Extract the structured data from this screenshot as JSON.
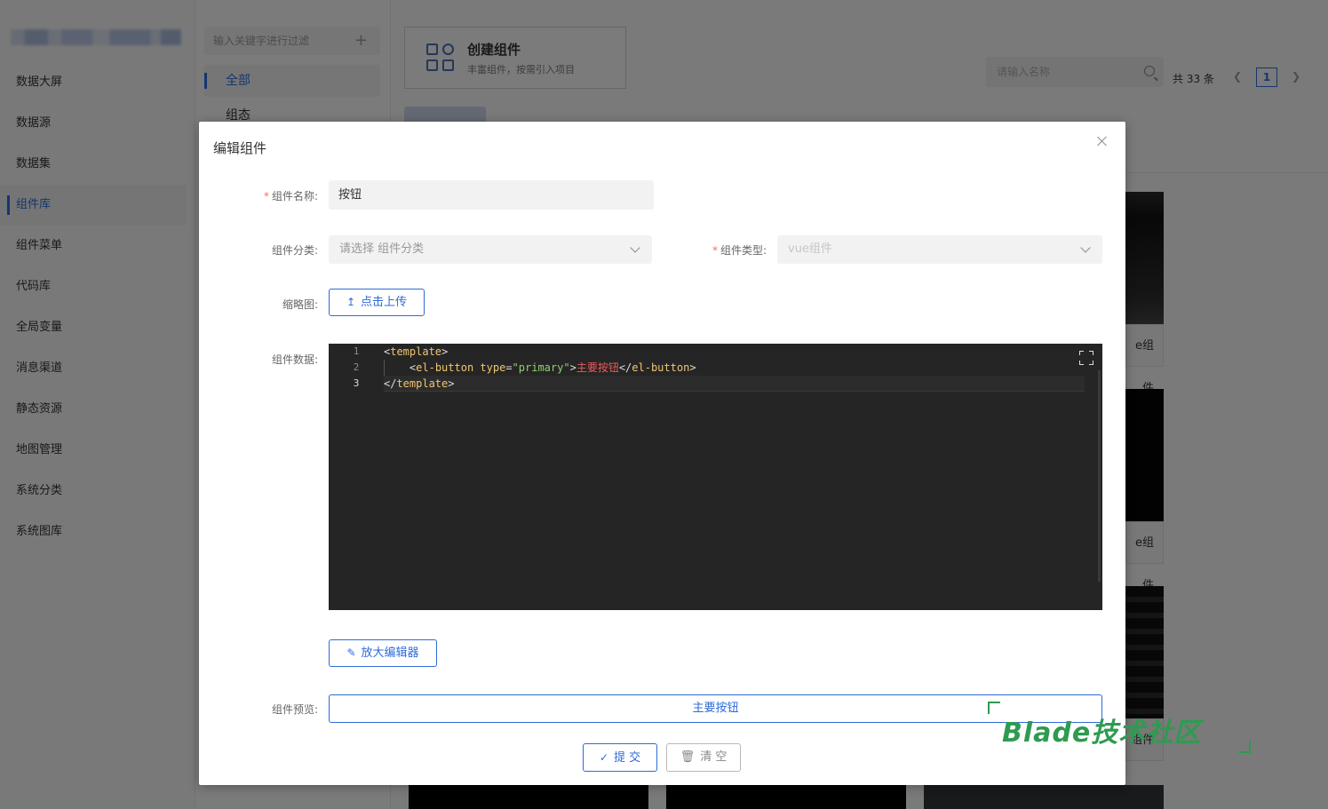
{
  "sidebar": {
    "items": [
      {
        "label": "数据大屏"
      },
      {
        "label": "数据源"
      },
      {
        "label": "数据集"
      },
      {
        "label": "组件库"
      },
      {
        "label": "组件菜单"
      },
      {
        "label": "代码库"
      },
      {
        "label": "全局变量"
      },
      {
        "label": "消息渠道"
      },
      {
        "label": "静态资源"
      },
      {
        "label": "地图管理"
      },
      {
        "label": "系统分类"
      },
      {
        "label": "系统图库"
      }
    ],
    "active_index": 3
  },
  "category_panel": {
    "filter_placeholder": "输入关键字进行过滤",
    "add_symbol": "+",
    "items": [
      {
        "label": "全部"
      },
      {
        "label": "组态"
      }
    ]
  },
  "main": {
    "create_card": {
      "title": "创建组件",
      "subtitle": "丰富组件，按需引入项目"
    },
    "search_placeholder": "请输入名称",
    "total": "共 33 条",
    "current_page": "1",
    "card_labels": [
      "e组件",
      "e组件",
      "组件"
    ]
  },
  "dialog": {
    "title": "编辑组件",
    "name_label": "组件名称:",
    "name_value": "按钮",
    "category_label": "组件分类:",
    "category_placeholder": "请选择 组件分类",
    "type_label": "组件类型:",
    "type_value": "vue组件",
    "thumbnail_label": "缩略图:",
    "upload_button": "点击上传",
    "data_label": "组件数据:",
    "code_lines": [
      {
        "n": "1"
      },
      {
        "n": "2"
      },
      {
        "n": "3"
      }
    ],
    "code": {
      "l1_tag": "template",
      "l2_tag": "el-button",
      "l2_attr": "type",
      "l2_value": "\"primary\"",
      "l2_text": "主要按钮",
      "l2_close_tag": "el-button",
      "l3_tag": "template"
    },
    "expand_editor_button": "放大编辑器",
    "preview_label": "组件预览:",
    "preview_button": "主要按钮",
    "submit_button": "提 交",
    "clear_button": "清 空"
  },
  "watermark": "Blade技术社区",
  "colors": {
    "primary": "#2f6bd8",
    "required": "#f56c6c",
    "editor_bg": "#252525",
    "watermark": "#2e9b50"
  }
}
